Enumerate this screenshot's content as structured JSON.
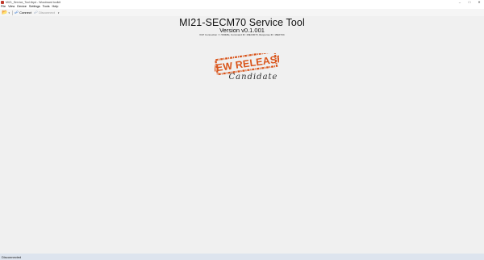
{
  "window": {
    "title": "MI21_Service_Tool.ifxpd - Woodward toolkit",
    "controls": [
      "–",
      "□",
      "✕"
    ]
  },
  "menu": [
    "File",
    "View",
    "Device",
    "Settings",
    "Tools",
    "Help"
  ],
  "toolbar": {
    "open_icon": "folder-open-icon",
    "connect_label": "Connect",
    "disconnect_label": "Disconnect"
  },
  "main": {
    "title": "MI21-SECM70 Service Tool",
    "version": "Version v0.1.001",
    "connection_info": "XCP Connection >> 500kBs, Command ID: 18EC0070, Response ID: 18EF70C",
    "stamp": {
      "line1": "NEW RELEASE",
      "line2": "Candidate",
      "color": "#d9541a"
    }
  },
  "status": {
    "text": "Disconnected"
  }
}
